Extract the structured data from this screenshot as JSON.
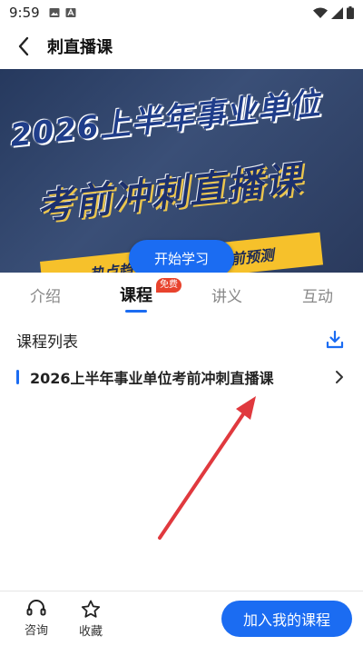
{
  "status_bar": {
    "time": "9:59",
    "icons_left": [
      "image-icon",
      "a-icon"
    ],
    "icons_right": [
      "wifi-icon",
      "signal-icon",
      "battery-icon"
    ]
  },
  "nav": {
    "title": "刺直播课",
    "back_icon": "back-arrow-icon"
  },
  "banner": {
    "headline_line1": "2026上半年事业单位",
    "headline_line2": "考前冲刺直播课",
    "tagline": "热点趋势·答题技巧·考前预测",
    "start_button": "开始学习"
  },
  "tabs": [
    {
      "label": "介绍",
      "active": false
    },
    {
      "label": "课程",
      "active": true,
      "badge": "免费"
    },
    {
      "label": "讲义",
      "active": false
    },
    {
      "label": "互动",
      "active": false
    }
  ],
  "course_list": {
    "title": "课程列表",
    "download_icon": "download-icon",
    "items": [
      {
        "name": "2026上半年事业单位考前冲刺直播课"
      }
    ]
  },
  "bottom_bar": {
    "consult_label": "咨询",
    "favorite_label": "收藏",
    "join_button": "加入我的课程"
  },
  "colors": {
    "accent": "#1b6cf2",
    "badge": "#e8432d",
    "annotation_arrow": "#e0393e"
  }
}
